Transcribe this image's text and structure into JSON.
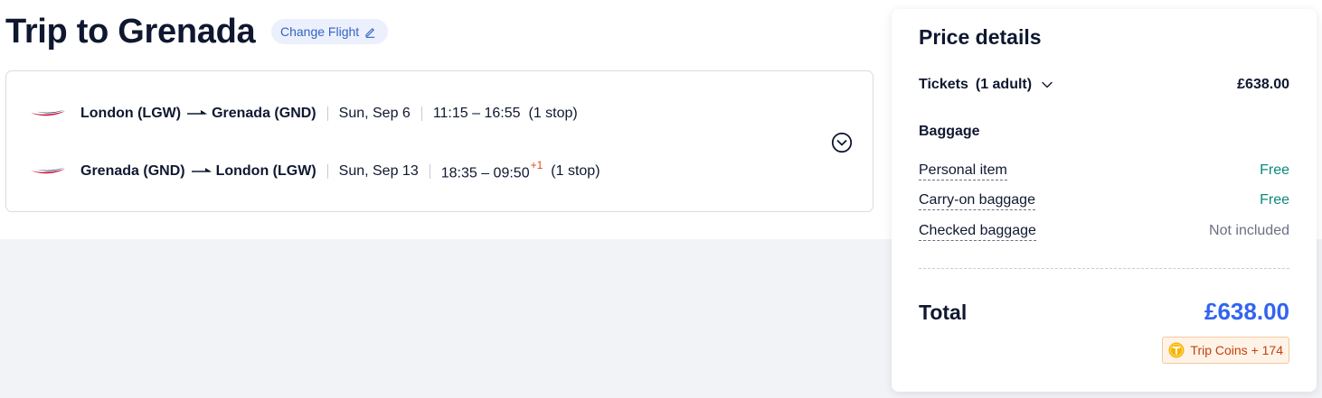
{
  "header": {
    "title": "Trip to Grenada",
    "change_flight_label": "Change Flight"
  },
  "flights": [
    {
      "route_from": "London (LGW)",
      "route_to": "Grenada (GND)",
      "date": "Sun, Sep 6",
      "times": "11:15 – 16:55",
      "day_offset": "",
      "stops": "(1 stop)",
      "airline_icon": "british-airways-speedmarque"
    },
    {
      "route_from": "Grenada (GND)",
      "route_to": "London (LGW)",
      "date": "Sun, Sep 13",
      "times": "18:35 – 09:50",
      "day_offset": "+1",
      "stops": "(1 stop)",
      "airline_icon": "british-airways-speedmarque"
    }
  ],
  "price_details": {
    "title": "Price details",
    "tickets_label": "Tickets",
    "tickets_count": "(1 adult)",
    "tickets_price": "£638.00",
    "baggage_heading": "Baggage",
    "baggage": [
      {
        "label": "Personal item",
        "value": "Free"
      },
      {
        "label": "Carry-on baggage",
        "value": "Free"
      },
      {
        "label": "Checked baggage",
        "value": "Not included"
      }
    ],
    "total_label": "Total",
    "total_value": "£638.00",
    "coins_label": "Trip Coins + 174"
  },
  "colors": {
    "accent_blue": "#3264f0",
    "free_green": "#0a8a7a",
    "day_offset_red": "#e2491c",
    "coins_orange": "#c2410c"
  }
}
